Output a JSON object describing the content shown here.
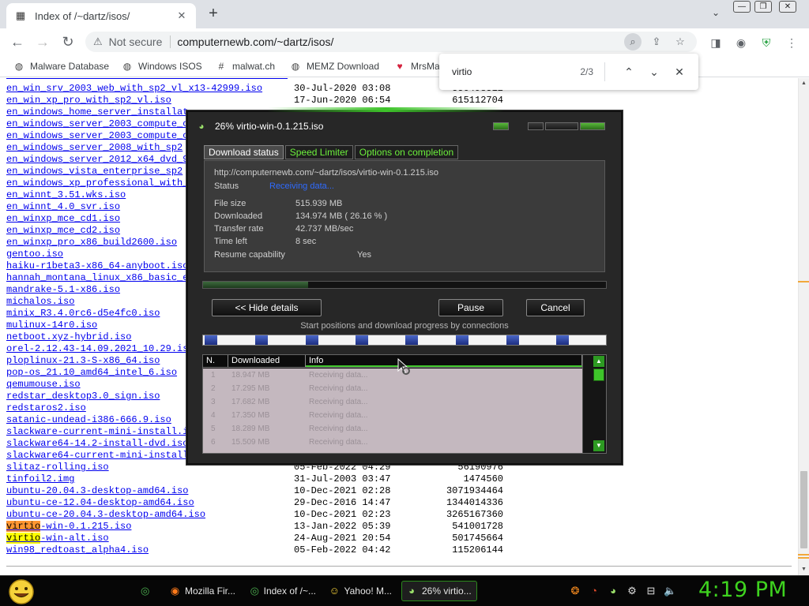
{
  "browser": {
    "tab": {
      "title": "Index of /~dartz/isos/",
      "close": "✕"
    },
    "new_tab": "+",
    "tab_dropdown": "⌄",
    "window_controls": [
      "—",
      "❐",
      "✕"
    ],
    "nav": {
      "back": "←",
      "forward": "→",
      "reload": "↻"
    },
    "address": {
      "security_label": "Not secure",
      "url": "computernewb.com/~dartz/isos/"
    },
    "bookmarks": [
      {
        "label": "Malware Database",
        "icon": "globe-icon"
      },
      {
        "label": "Windows ISOS",
        "icon": "globe-icon"
      },
      {
        "label": "malwat.ch",
        "icon": "hashtag-icon"
      },
      {
        "label": "MEMZ Download",
        "icon": "globe-icon"
      },
      {
        "label": "MrsMa",
        "icon": "heart-icon"
      }
    ]
  },
  "findbar": {
    "query": "virtio",
    "count": "2/3",
    "prev": "⌃",
    "next": "⌄",
    "close": "✕"
  },
  "listing": [
    {
      "name": "en_win_srv_2003_web_with_sp2_vl_x13-42999.iso",
      "date": "30-Jul-2020 03:08",
      "size": "550498512"
    },
    {
      "name": "en_win_xp_pro_with_sp2_vl.iso",
      "date": "17-Jun-2020 06:54",
      "size": "615112704"
    },
    {
      "name": "en_windows_home_server_installat",
      "date": "",
      "size": ""
    },
    {
      "name": "en_windows_server_2003_compute_c",
      "date": "",
      "size": ""
    },
    {
      "name": "en_windows_server_2003_compute_c",
      "date": "",
      "size": ""
    },
    {
      "name": "en_windows_server_2008_with_sp2",
      "date": "",
      "size": ""
    },
    {
      "name": "en_windows_server_2012_x64_dvd_9",
      "date": "",
      "size": ""
    },
    {
      "name": "en_windows_vista_enterprise_sp2",
      "date": "",
      "size": ""
    },
    {
      "name": "en_windows_xp_professional_with_",
      "date": "",
      "size": ""
    },
    {
      "name": "en_winnt_3.51.wks.iso",
      "date": "",
      "size": ""
    },
    {
      "name": "en_winnt_4.0_svr.iso",
      "date": "",
      "size": ""
    },
    {
      "name": "en_winxp_mce_cd1.iso",
      "date": "",
      "size": ""
    },
    {
      "name": "en_winxp_mce_cd2.iso",
      "date": "",
      "size": ""
    },
    {
      "name": "en_winxp_pro_x86_build2600.iso",
      "date": "",
      "size": ""
    },
    {
      "name": "gentoo.iso",
      "date": "",
      "size": ""
    },
    {
      "name": "haiku-r1beta3-x86_64-anyboot.iso",
      "date": "",
      "size": ""
    },
    {
      "name": "hannah_montana_linux_x86_basic_e",
      "date": "",
      "size": ""
    },
    {
      "name": "mandrake-5.1-x86.iso",
      "date": "",
      "size": ""
    },
    {
      "name": "michalos.iso",
      "date": "",
      "size": ""
    },
    {
      "name": "minix_R3.4.0rc6-d5e4fc0.iso",
      "date": "",
      "size": ""
    },
    {
      "name": "mulinux-14r0.iso",
      "date": "",
      "size": ""
    },
    {
      "name": "netboot.xyz-hybrid.iso",
      "date": "",
      "size": ""
    },
    {
      "name": "orel-2.12.43-14.09.2021_10.29.is",
      "date": "",
      "size": ""
    },
    {
      "name": "ploplinux-21.3-S-x86_64.iso",
      "date": "",
      "size": ""
    },
    {
      "name": "pop-os_21.10_amd64_intel_6.iso",
      "date": "",
      "size": ""
    },
    {
      "name": "qemumouse.iso",
      "date": "",
      "size": ""
    },
    {
      "name": "redstar_desktop3.0_sign.iso",
      "date": "",
      "size": ""
    },
    {
      "name": "redstaros2.iso",
      "date": "",
      "size": ""
    },
    {
      "name": "satanic-undead-i386-666.9.iso",
      "date": "",
      "size": ""
    },
    {
      "name": "slackware-current-mini-install.i",
      "date": "",
      "size": ""
    },
    {
      "name": "slackware64-14.2-install-dvd.iso",
      "date": "",
      "size": ""
    },
    {
      "name": "slackware64-current-mini-install",
      "date": "",
      "size": ""
    },
    {
      "name": "slitaz-rolling.iso",
      "date": "05-Feb-2022 04:29",
      "size": "56190976"
    },
    {
      "name": "tinfoil2.img",
      "date": "31-Jul-2003 03:47",
      "size": "1474560"
    },
    {
      "name": "ubuntu-20.04.3-desktop-amd64.iso",
      "date": "10-Dec-2021 02:28",
      "size": "3071934464"
    },
    {
      "name": "ubuntu-ce-12.04-desktop-amd64.iso",
      "date": "29-Dec-2016 14:47",
      "size": "1344014336"
    },
    {
      "name": "ubuntu-ce-20.04.3-desktop-amd64.iso",
      "date": "10-Dec-2021 02:23",
      "size": "3265167360"
    },
    {
      "name": "-win-0.1.215.iso",
      "match": "virtio",
      "match_state": "current",
      "date": "13-Jan-2022 05:39",
      "size": "541001728"
    },
    {
      "name": "-win-alt.iso",
      "match": "virtio",
      "match_state": "other",
      "date": "24-Aug-2021 20:54",
      "size": "501745664"
    },
    {
      "name": "win98_redtoast_alpha4.iso",
      "date": "05-Feb-2022 04:42",
      "size": "115206144"
    }
  ],
  "download": {
    "title": "26% virtio-win-0.1.215.iso",
    "tabs": [
      "Download status",
      "Speed Limiter",
      "Options on completion"
    ],
    "url": "http://computernewb.com/~dartz/isos/virtio-win-0.1.215.iso",
    "status_label": "Status",
    "status_value": "Receiving data...",
    "fields": [
      {
        "label": "File size",
        "value": "515.939  MB"
      },
      {
        "label": "Downloaded",
        "value": "134.974  MB  ( 26.16 % )"
      },
      {
        "label": "Transfer rate",
        "value": "42.737  MB/sec"
      },
      {
        "label": "Time left",
        "value": "8 sec"
      },
      {
        "label": "Resume capability",
        "value": "Yes"
      }
    ],
    "progress": 0.2616,
    "buttons": {
      "hide": "<< Hide details",
      "pause": "Pause",
      "cancel": "Cancel"
    },
    "conn_caption": "Start positions and download progress by connections",
    "table_headers": [
      "N.",
      "Downloaded",
      "Info"
    ],
    "connections": [
      {
        "n": "1",
        "downloaded": "18.947 MB",
        "info": "Receiving data..."
      },
      {
        "n": "2",
        "downloaded": "17.295 MB",
        "info": "Receiving data..."
      },
      {
        "n": "3",
        "downloaded": "17.682 MB",
        "info": "Receiving data..."
      },
      {
        "n": "4",
        "downloaded": "17.350 MB",
        "info": "Receiving data..."
      },
      {
        "n": "5",
        "downloaded": "18.289 MB",
        "info": "Receiving data..."
      },
      {
        "n": "6",
        "downloaded": "15.509 MB",
        "info": "Receiving data..."
      }
    ]
  },
  "taskbar": {
    "tasks": [
      {
        "label": "",
        "icon": "chrome-icon"
      },
      {
        "label": "Mozilla Fir...",
        "icon": "firefox-icon"
      },
      {
        "label": "Index of /~...",
        "icon": "chrome-icon"
      },
      {
        "label": "Yahoo! M...",
        "icon": "yahoo-messenger-icon"
      },
      {
        "label": "26% virtio...",
        "icon": "idm-icon"
      }
    ],
    "clock": "4:19 PM"
  },
  "colors": {
    "link": "#0000ee",
    "find_current": "#ff9632",
    "find_other": "#ffff00",
    "idm_green": "#6cf03c",
    "clock_green": "#3ed21f"
  }
}
